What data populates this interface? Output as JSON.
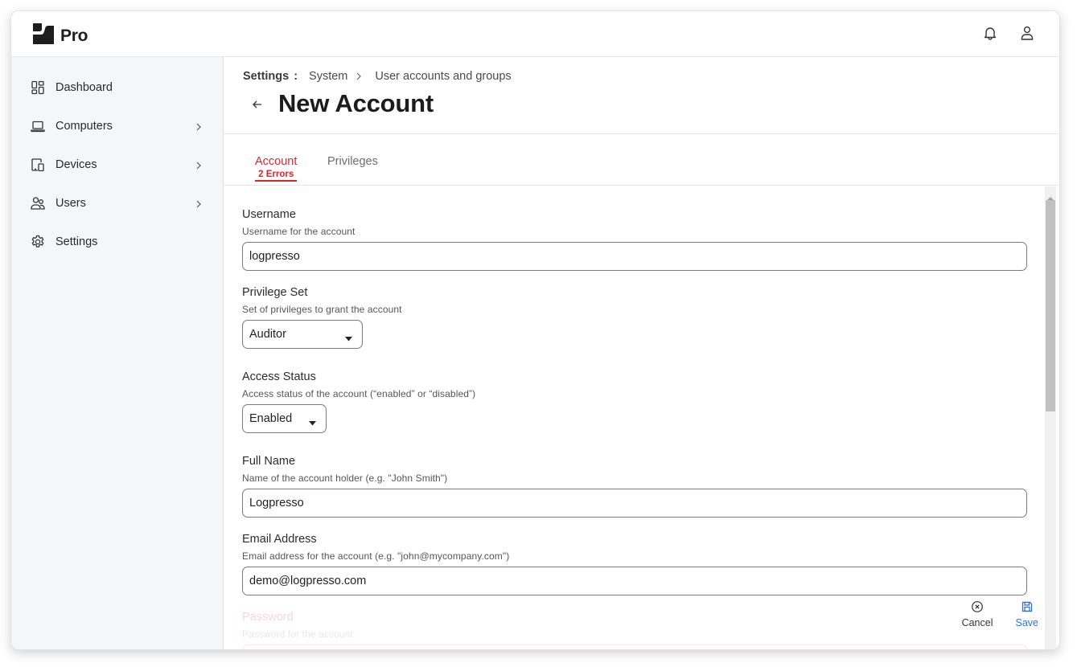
{
  "app": {
    "brand_name": "Pro",
    "icons": {
      "logo": "brand-logo",
      "notifications": "bell-icon",
      "profile": "user-icon"
    }
  },
  "sidebar": {
    "items": [
      {
        "label": "Dashboard",
        "icon": "dashboard-icon",
        "has_children": false
      },
      {
        "label": "Computers",
        "icon": "laptop-icon",
        "has_children": true
      },
      {
        "label": "Devices",
        "icon": "devices-icon",
        "has_children": true
      },
      {
        "label": "Users",
        "icon": "users-icon",
        "has_children": true
      },
      {
        "label": "Settings",
        "icon": "gear-icon",
        "has_children": false
      }
    ]
  },
  "breadcrumb": {
    "root": "Settings",
    "separator": ":",
    "items": [
      "System",
      "User accounts and groups"
    ]
  },
  "page": {
    "title": "New Account"
  },
  "tabs": [
    {
      "label": "Account",
      "badge": "2 Errors",
      "active": true
    },
    {
      "label": "Privileges",
      "active": false
    }
  ],
  "form": {
    "fields": [
      {
        "label": "Username",
        "help": "Username for the account",
        "type": "text",
        "value": "logpresso"
      },
      {
        "label": "Privilege Set",
        "help": "Set of privileges to grant the account",
        "type": "select",
        "value": "Auditor"
      },
      {
        "label": "Access Status",
        "help": "Access status of the account (“enabled” or “disabled”)",
        "type": "select",
        "value": "Enabled"
      },
      {
        "label": "Full Name",
        "help": "Name of the account holder (e.g. \"John Smith\")",
        "type": "text",
        "value": "Logpresso"
      },
      {
        "label": "Email Address",
        "help": "Email address for the account (e.g. \"john@mycompany.com\")",
        "type": "text",
        "value": "demo@logpresso.com"
      },
      {
        "label": "Password",
        "help": "Password for the account",
        "type": "password",
        "value": ""
      }
    ]
  },
  "actions": {
    "cancel_label": "Cancel",
    "save_label": "Save"
  },
  "colors": {
    "error": "#d9262c",
    "primary": "#2e6fe0",
    "sidebar_bg": "#f5f6f8"
  }
}
